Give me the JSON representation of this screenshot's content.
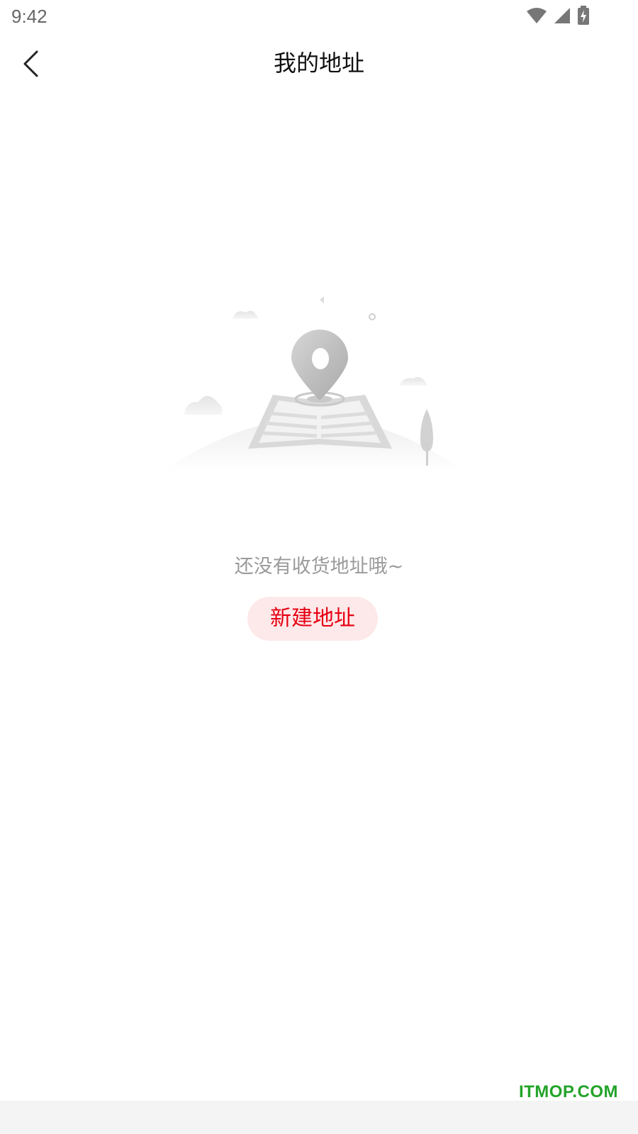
{
  "status_bar": {
    "time": "9:42",
    "icons": [
      "wifi-icon",
      "cellular-signal-icon",
      "battery-charging-icon"
    ]
  },
  "header": {
    "back_icon": "chevron-left-icon",
    "title": "我的地址"
  },
  "empty_state": {
    "illustration": "map-pin-on-book-illustration",
    "message": "还没有收货地址哦~",
    "button_label": "新建地址"
  },
  "watermark": "ITMOP.COM",
  "colors": {
    "accent": "#e60012",
    "button_bg": "#fde9e9",
    "muted_text": "#9a9a9a",
    "watermark": "#23a32a"
  }
}
